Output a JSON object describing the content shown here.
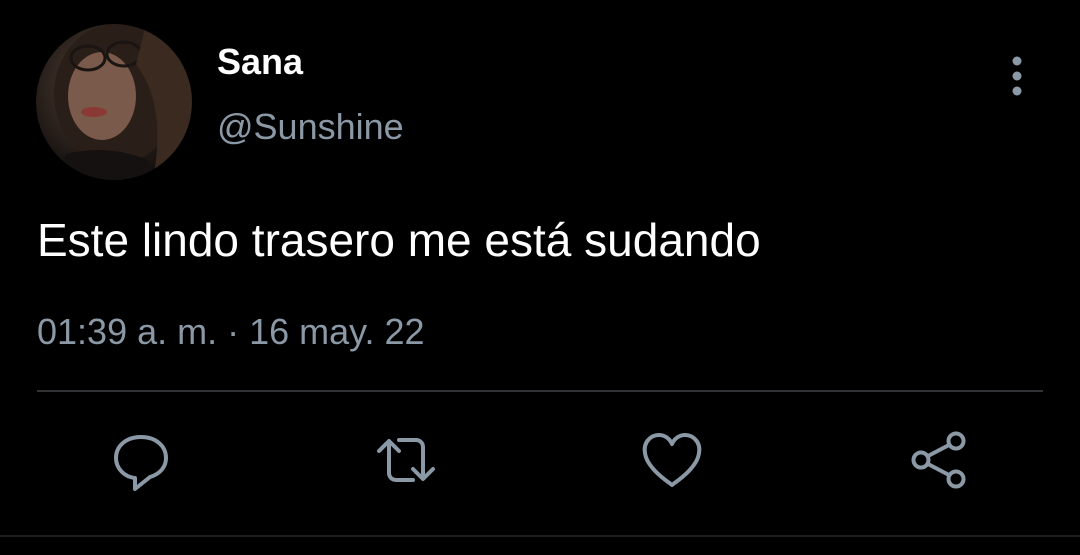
{
  "author": {
    "display_name": "Sana",
    "handle": "@Sunshine"
  },
  "tweet": {
    "text": "Este lindo trasero me está sudando",
    "time": "01:39 a. m.",
    "separator": "·",
    "date": "16 may. 22"
  },
  "actions": {
    "reply": "reply-icon",
    "retweet": "retweet-icon",
    "like": "heart-icon",
    "share": "share-icon"
  },
  "colors": {
    "background": "#000000",
    "text": "#ffffff",
    "muted": "#8b98a5",
    "divider": "#2f3336"
  }
}
